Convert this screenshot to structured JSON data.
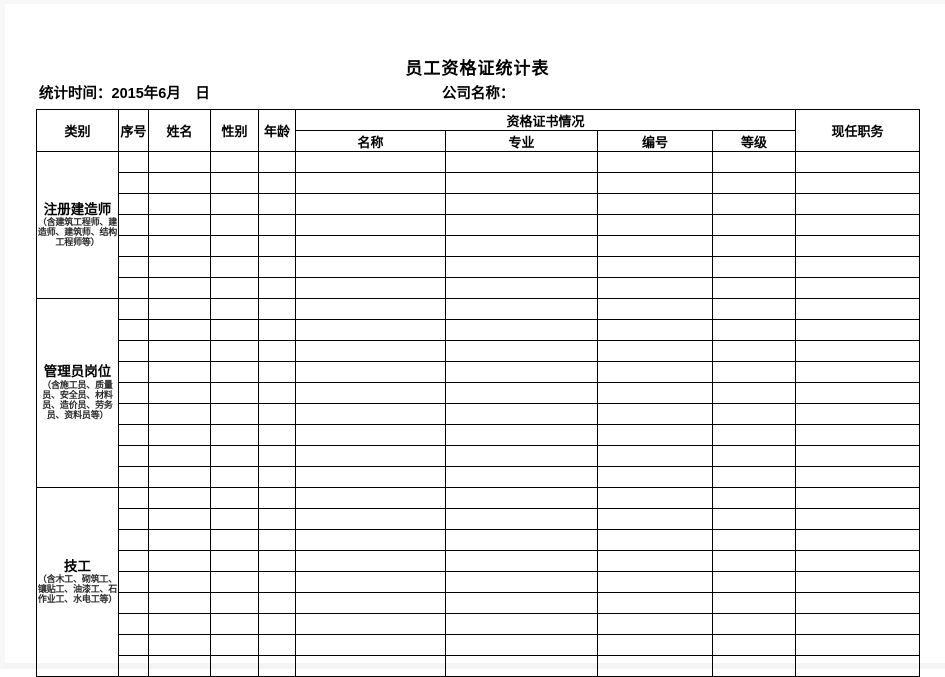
{
  "document": {
    "title": "员工资格证统计表",
    "meta": {
      "date_label": "统计时间：2015年6月　日",
      "company_label": "公司名称："
    }
  },
  "table": {
    "headers": {
      "category": "类别",
      "index": "序号",
      "name": "姓名",
      "gender": "性别",
      "age": "年龄",
      "cert_group": "资格证书情况",
      "cert_name": "名称",
      "cert_major": "专业",
      "cert_number": "编号",
      "cert_level": "等级",
      "current_post": "现任职务"
    },
    "bands": [
      {
        "main": "注册建造师",
        "sub": "（含建筑工程师、建造师、建筑师、结构工程师等）",
        "rows": 7
      },
      {
        "main": "管理员岗位",
        "sub": "（含施工员、质量员、安全员、材料员、造价员、劳务员、资料员等）",
        "rows": 9
      },
      {
        "main": "技工",
        "sub": "（含木工、砌筑工、镶贴工、油漆工、石作业工、水电工等）",
        "rows": 9
      }
    ]
  },
  "colors": {
    "grid_dark": "#000000",
    "grid_light": "#a6a6a6",
    "page_background": "#ffffff",
    "text": "#000000"
  }
}
